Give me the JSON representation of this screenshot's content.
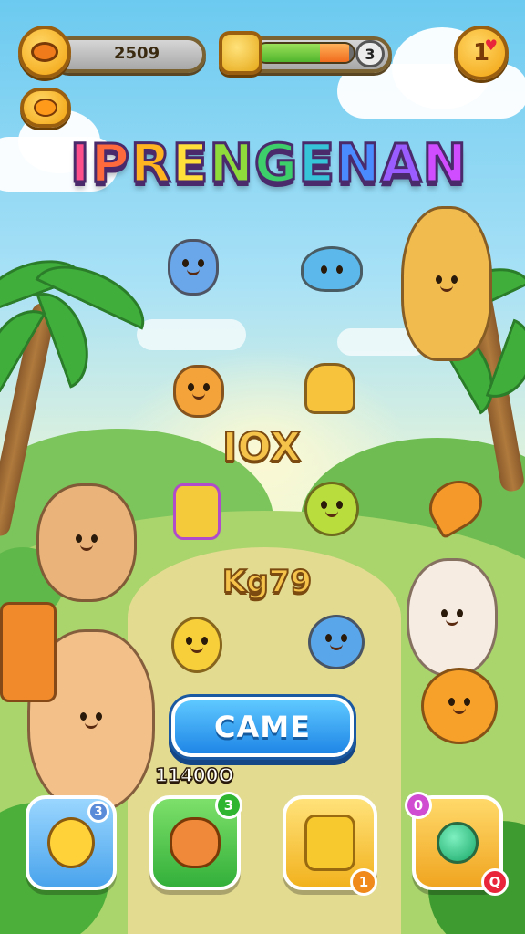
{
  "hud": {
    "coins_value": "2509",
    "energy_value": "3",
    "energy_fill_green": 0.65,
    "energy_fill_orange": 0.3,
    "lives_value": "1"
  },
  "title": {
    "letters": [
      "I",
      "P",
      "R",
      "E",
      "N",
      "G",
      "E",
      "N",
      "A",
      "N"
    ],
    "colors": [
      "#ff4f8a",
      "#ff6a3d",
      "#ffb420",
      "#ffe03a",
      "#8fdb3c",
      "#3ccf6a",
      "#36c4d8",
      "#4a8cff",
      "#9b5cff",
      "#d04cff"
    ]
  },
  "labels": {
    "label_one": "IOX",
    "label_two": "Kg79"
  },
  "play_button": {
    "label": "CAME"
  },
  "score": {
    "value": "11400O"
  },
  "inventory": [
    {
      "badge": "3",
      "badge_color": "#5a8bd8"
    },
    {
      "badge": "3",
      "badge_color": "#2fb52f"
    },
    {
      "badge": "1",
      "badge_color": "#f08a1c"
    },
    {
      "badge": "0",
      "badge_color": "#d04cd0",
      "badge2": "Q"
    }
  ],
  "colors": {
    "accent_blue": "#1f86e6",
    "gold": "#f5c24a",
    "grass": "#4caf3a"
  }
}
